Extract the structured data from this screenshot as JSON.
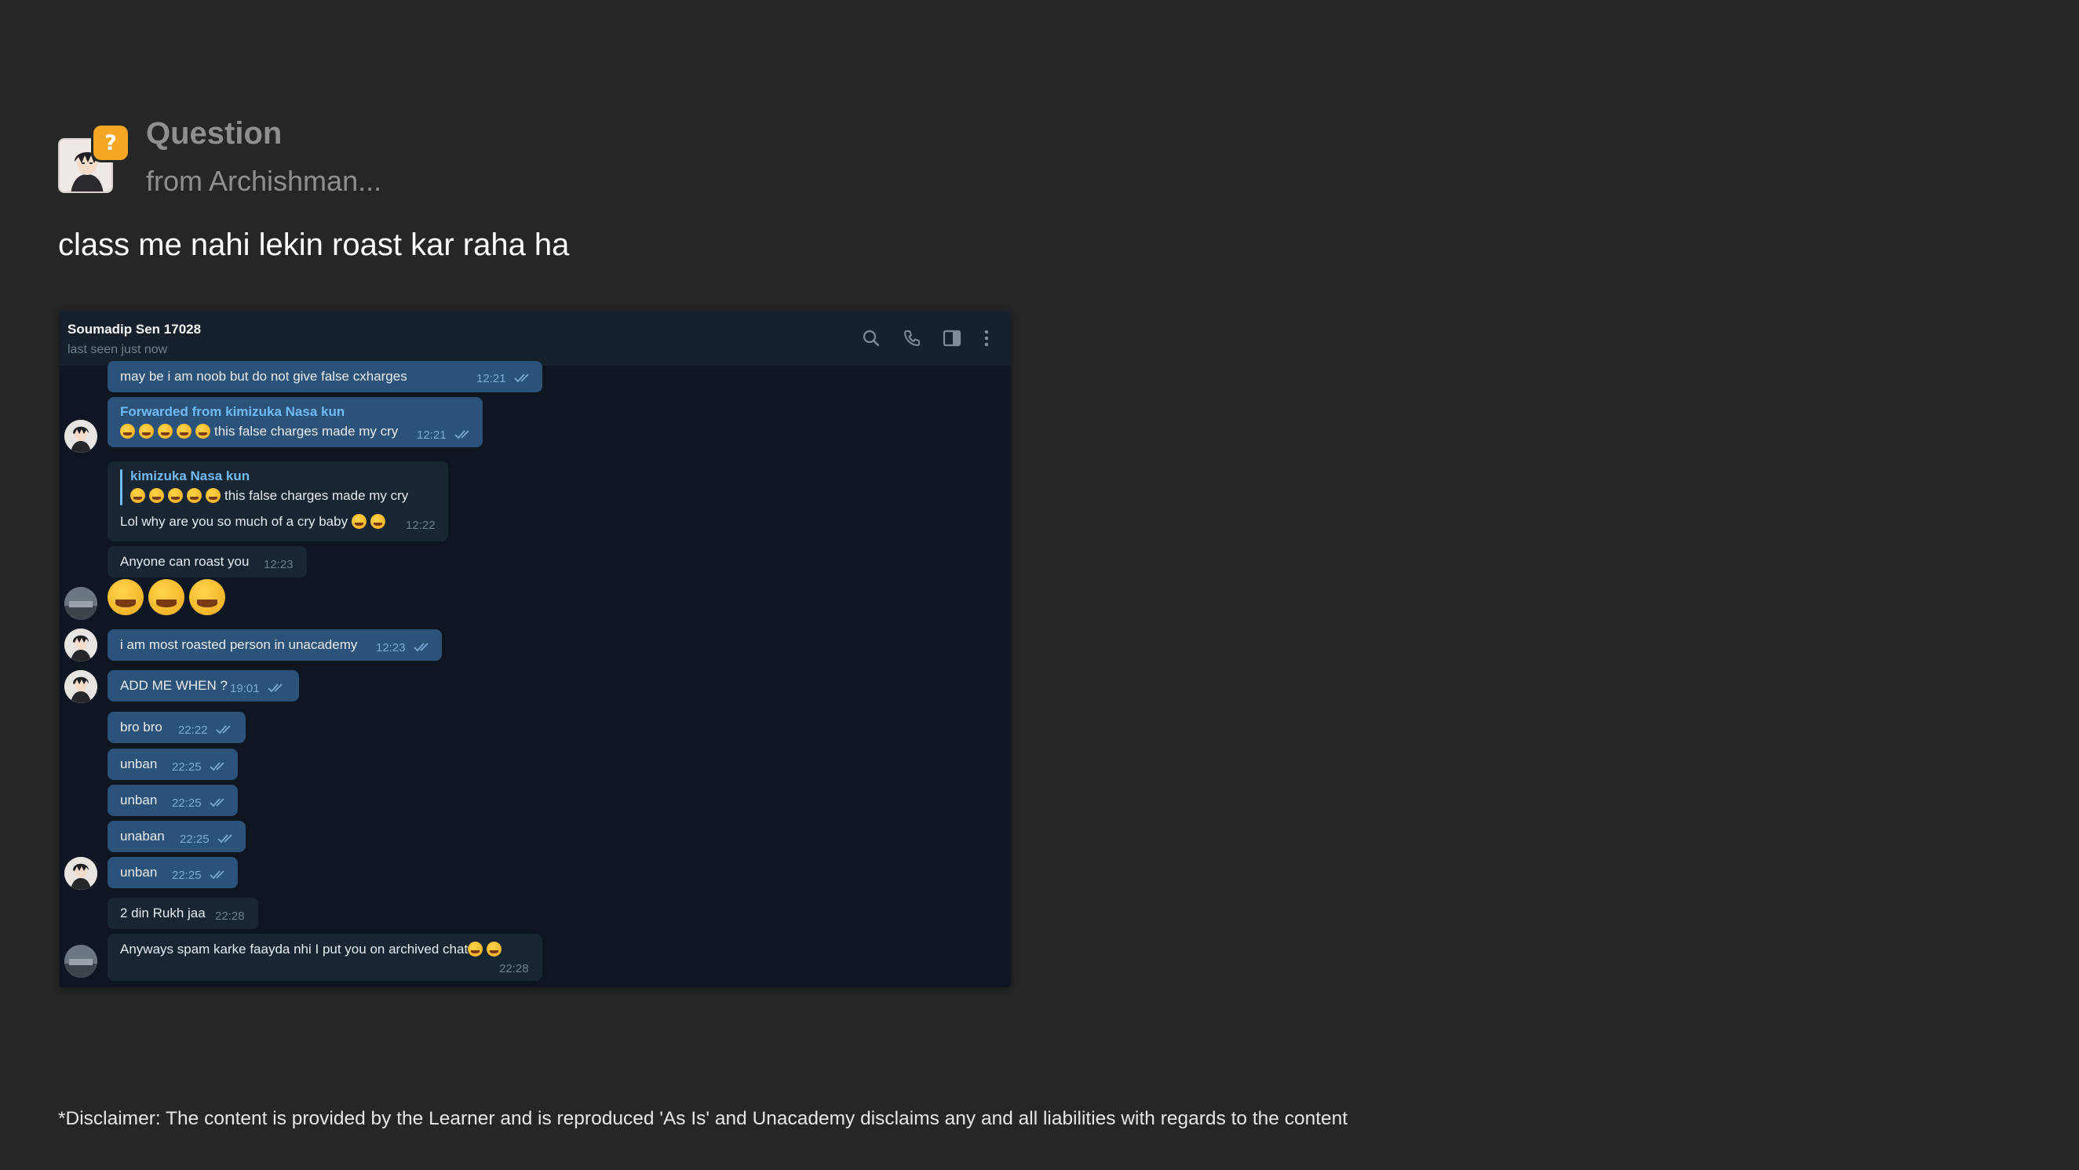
{
  "question": {
    "title": "Question",
    "from": "from Archishman...",
    "badge": "?",
    "text": "class me nahi lekin roast kar raha ha"
  },
  "disclaimer": "*Disclaimer: The content is provided by the Learner and is reproduced 'As Is' and Unacademy disclaims any and all liabilities with regards to the content",
  "chat": {
    "contact_name": "Soumadip Sen 17028",
    "status": "last seen just now",
    "icons": [
      "search-icon",
      "phone-icon",
      "sidebar-toggle-icon",
      "more-vertical-icon"
    ],
    "messages": [
      {
        "dir": "out",
        "text": "may be i am noob but do not give false cxharges",
        "time": "12:21",
        "read": true
      },
      {
        "dir": "out",
        "forwarded_from": "Forwarded from kimizuka Nasa kun",
        "text": "this false charges made my cry",
        "emoji_count": 5,
        "time": "12:21",
        "read": true
      },
      {
        "dir": "in",
        "reply_name": "kimizuka Nasa kun",
        "reply_text": "this false charges made my cry",
        "text": "Lol why are you so much of a cry baby",
        "time": "12:22"
      },
      {
        "dir": "in",
        "text": "Anyone can roast you",
        "time": "12:23"
      },
      {
        "dir": "in",
        "emoji_only": 3
      },
      {
        "dir": "out",
        "text": "i am most roasted person in unacademy",
        "time": "12:23",
        "read": true
      },
      {
        "dir": "out",
        "text": "ADD ME WHEN ?",
        "time": "19:01",
        "read": true
      },
      {
        "dir": "out",
        "text": "bro bro",
        "time": "22:22",
        "read": true
      },
      {
        "dir": "out",
        "text": "unban",
        "time": "22:25",
        "read": true
      },
      {
        "dir": "out",
        "text": "unban",
        "time": "22:25",
        "read": true
      },
      {
        "dir": "out",
        "text": "unaban",
        "time": "22:25",
        "read": true
      },
      {
        "dir": "out",
        "text": "unban",
        "time": "22:25",
        "read": true
      },
      {
        "dir": "in",
        "text": "2 din Rukh jaa",
        "time": "22:28"
      },
      {
        "dir": "in",
        "text": "Anyways spam karke faayda nhi I put you on archived chat",
        "time": "22:28"
      }
    ]
  },
  "colors": {
    "page_bg": "#262626",
    "chat_bg": "#0e1621",
    "outgoing_bubble": "#2b5278",
    "incoming_bubble": "#182533",
    "accent_badge": "#f5a623",
    "link_blue": "#71baf5"
  }
}
